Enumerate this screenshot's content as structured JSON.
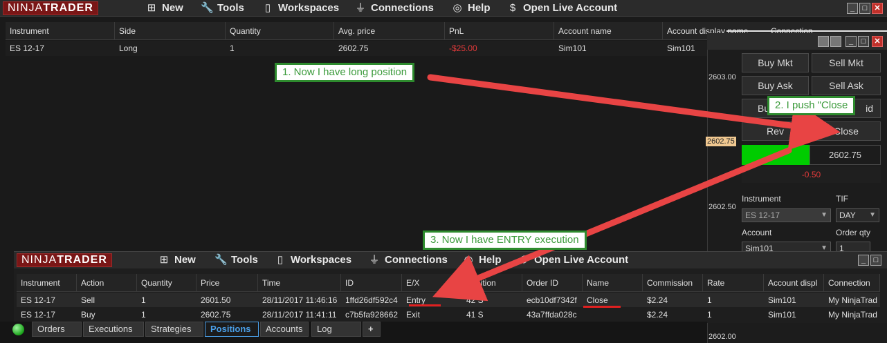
{
  "app": {
    "logo_a": "NINJA",
    "logo_b": "TRADER"
  },
  "menu": {
    "new": "New",
    "tools": "Tools",
    "workspaces": "Workspaces",
    "connections": "Connections",
    "help": "Help",
    "live": "Open Live Account"
  },
  "positions": {
    "headers": [
      "Instrument",
      "Side",
      "Quantity",
      "Avg. price",
      "PnL",
      "Account name",
      "Account display name",
      "Connection"
    ],
    "row": {
      "instrument": "ES 12-17",
      "side": "Long",
      "quantity": "1",
      "avg_price": "2602.75",
      "pnl": "-$25.00",
      "account": "Sim101",
      "display": "Sim101"
    }
  },
  "chart_trader": {
    "buy_mkt": "Buy Mkt",
    "sell_mkt": "Sell Mkt",
    "buy_ask": "Buy Ask",
    "sell_ask": "Sell Ask",
    "buy_bid_part": "Bu",
    "sell_bid_part": "id",
    "rev_part": "Rev",
    "close": "Close",
    "position_price": "2602.75",
    "unrealized": "-0.50",
    "instrument_label": "Instrument",
    "instrument_value": "ES 12-17",
    "tif_label": "TIF",
    "tif_value": "DAY",
    "account_label": "Account",
    "account_value": "Sim101",
    "qty_label": "Order qty",
    "qty_value": "1",
    "prices": [
      "2603.00",
      "2602.75",
      "2602.50",
      "2602.00"
    ]
  },
  "executions": {
    "headers": [
      "Instrument",
      "Action",
      "Quantity",
      "Price",
      "Time",
      "ID",
      "E/X",
      "Position",
      "Order ID",
      "Name",
      "Commission",
      "Rate",
      "Account displ",
      "Connection"
    ],
    "rows": [
      [
        "ES 12-17",
        "Sell",
        "1",
        "2601.50",
        "28/11/2017 11:46:16",
        "1ffd26df592c4",
        "Entry",
        "42 S",
        "ecb10df7342f",
        "Close",
        "$2.24",
        "1",
        "Sim101",
        "My NinjaTrad"
      ],
      [
        "ES 12-17",
        "Buy",
        "1",
        "2602.75",
        "28/11/2017 11:41:11",
        "c7b5fa928662",
        "Exit",
        "41 S",
        "43a7ffda028c",
        "",
        "$2.24",
        "1",
        "Sim101",
        "My NinjaTrad"
      ]
    ]
  },
  "tabs": [
    "Orders",
    "Executions",
    "Strategies",
    "Positions",
    "Accounts",
    "Log",
    "+"
  ],
  "notes": {
    "n1": "1. Now I have long position",
    "n2": "2. I push \"Close",
    "n3": "3. Now  I have ENTRY execution"
  },
  "colors": {
    "accent": "#4a9fe8",
    "brand": "#7a1616",
    "loss": "#e23a3a",
    "note_border": "#2e8b2e",
    "arrow": "#e84444",
    "long_bar": "#00cc00"
  }
}
